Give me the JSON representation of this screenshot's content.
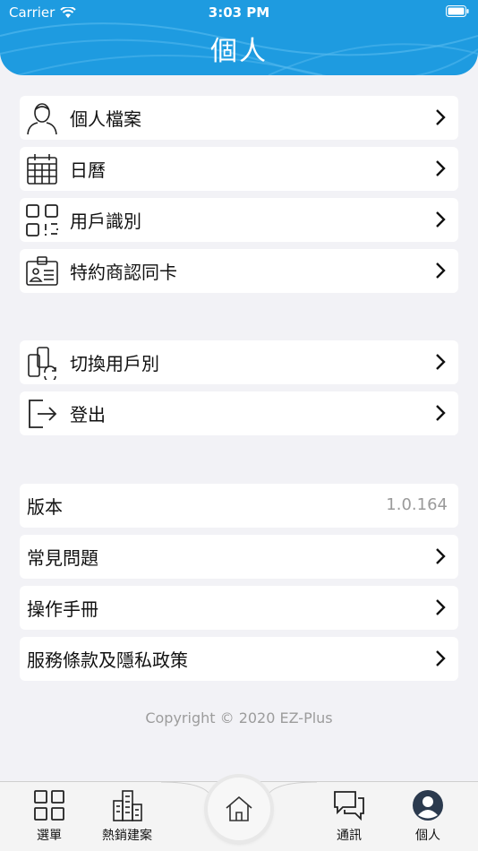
{
  "status_bar": {
    "carrier": "Carrier",
    "time": "3:03 PM"
  },
  "header": {
    "title": "個人"
  },
  "group1": [
    {
      "label": "個人檔案",
      "icon": "person-icon"
    },
    {
      "label": "日曆",
      "icon": "calendar-icon"
    },
    {
      "label": "用戶識別",
      "icon": "qr-code-icon"
    },
    {
      "label": "特約商認同卡",
      "icon": "id-card-icon"
    }
  ],
  "group2": [
    {
      "label": "切換用戶別",
      "icon": "switch-user-icon"
    },
    {
      "label": "登出",
      "icon": "logout-icon"
    }
  ],
  "group3": {
    "version_label": "版本",
    "version_value": "1.0.164",
    "faq": "常見問題",
    "manual": "操作手冊",
    "terms": "服務條款及隱私政策"
  },
  "copyright": "Copyright © 2020 EZ-Plus",
  "tabbar": {
    "menu": "選單",
    "hot_projects": "熱銷建案",
    "messages": "通訊",
    "personal": "個人"
  },
  "colors": {
    "accent": "#1e9be0",
    "background": "#f2f2f6"
  }
}
